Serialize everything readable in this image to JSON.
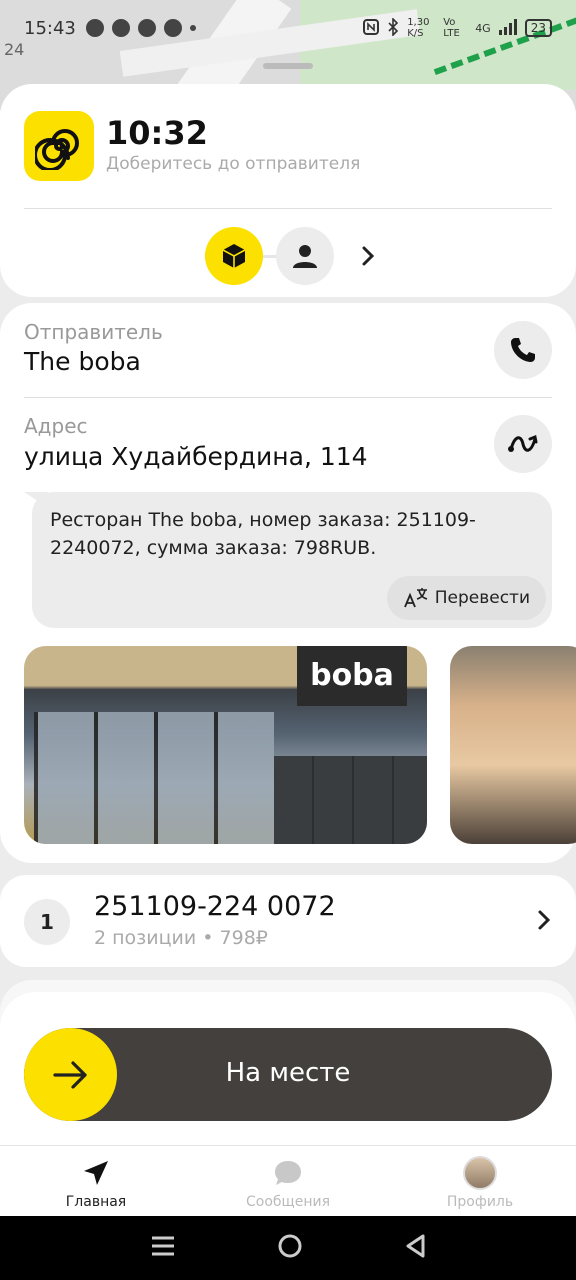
{
  "status_bar": {
    "time": "15:43",
    "speed": "1,30 K/S",
    "network": "4G",
    "volte": "Vo LTE",
    "battery": "23"
  },
  "map": {
    "label": "24"
  },
  "header": {
    "eta_time": "10:32",
    "eta_subtitle": "Доберитесь до отправителя"
  },
  "sender": {
    "label": "Отправитель",
    "name": "The boba"
  },
  "address": {
    "label": "Адрес",
    "value": "улица Худайбердина, 114"
  },
  "comment": {
    "text": "Ресторан The boba, номер заказа: 251109-2240072, сумма заказа: 798RUB.",
    "translate_label": "Перевести"
  },
  "photos": {
    "sign_text": "boba"
  },
  "order": {
    "index": "1",
    "id": "251109-224 0072",
    "summary": "2 позиции • 798₽"
  },
  "action": {
    "label": "На месте"
  },
  "bottom_nav": {
    "items": [
      {
        "label": "Главная",
        "icon": "navigation-arrow-icon",
        "active": true
      },
      {
        "label": "Сообщения",
        "icon": "chat-bubble-icon",
        "active": false
      },
      {
        "label": "Профиль",
        "icon": "avatar",
        "active": false
      }
    ]
  },
  "colors": {
    "accent": "#fce000",
    "dark_button": "#43403d",
    "route": "#1ea14a"
  }
}
